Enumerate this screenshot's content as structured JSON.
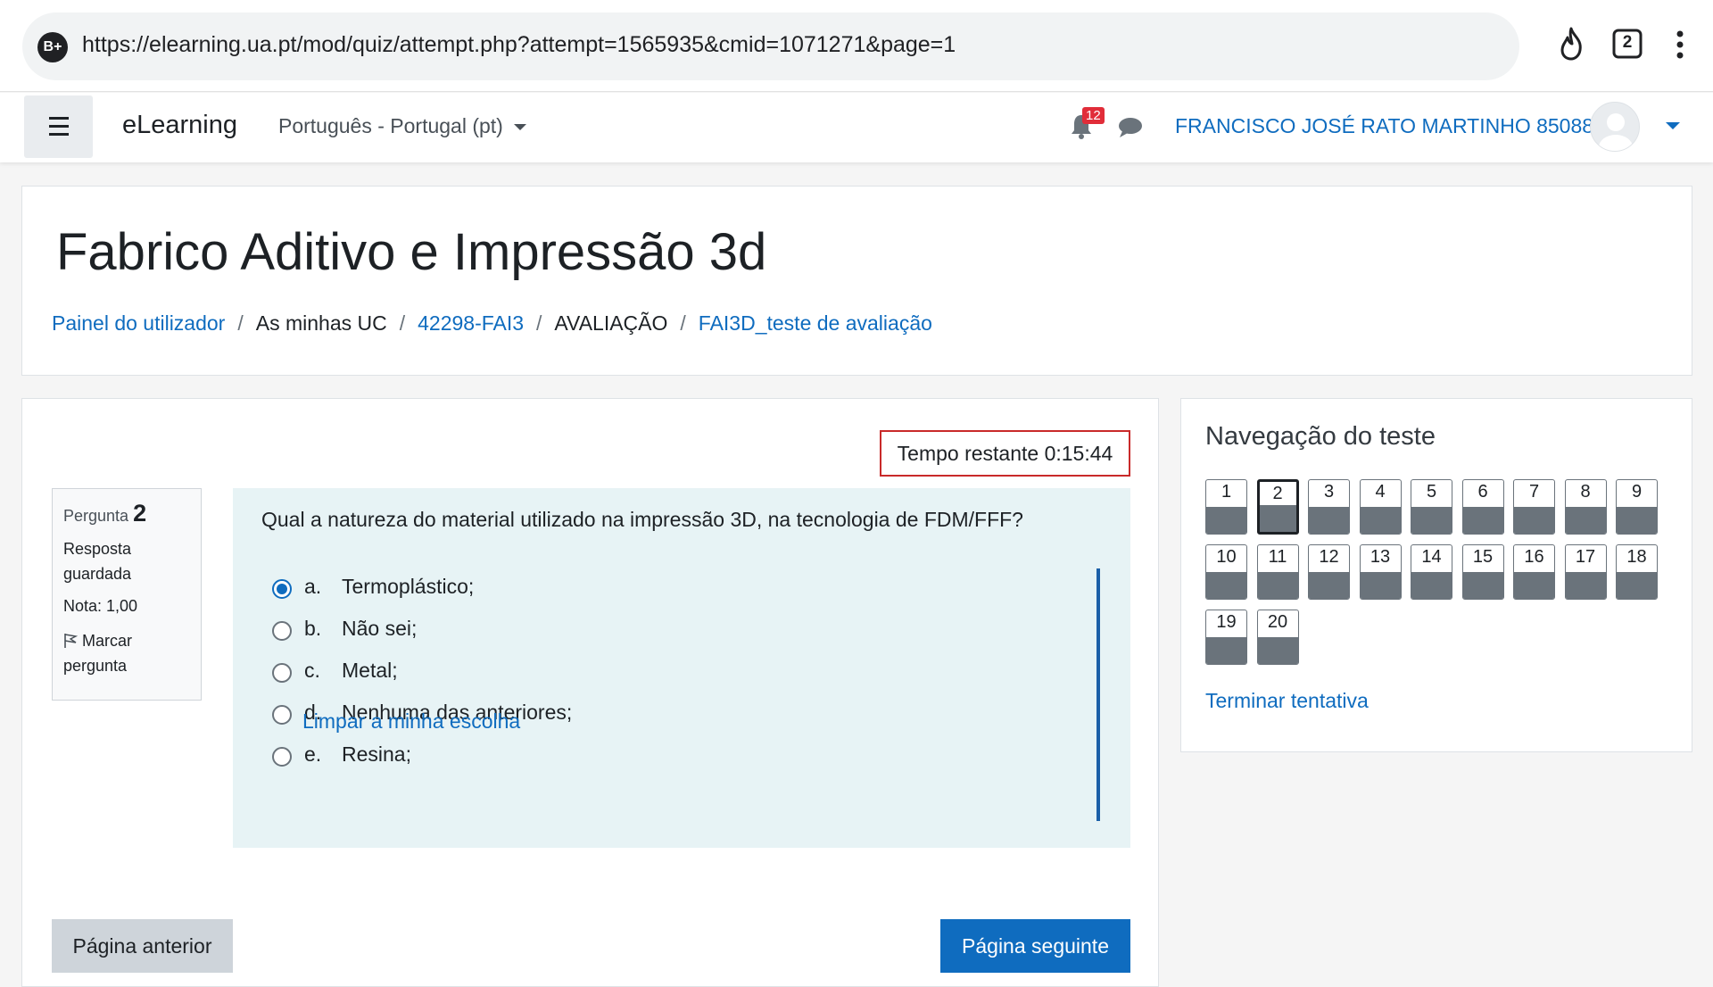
{
  "browser": {
    "site_badge": "B+",
    "url": "https://elearning.ua.pt/mod/quiz/attempt.php?attempt=1565935&cmid=1071271&page=1",
    "tab_count": "2"
  },
  "navbar": {
    "brand": "eLearning",
    "language": "Português - Portugal (pt)",
    "notification_count": "12",
    "user_name": "FRANCISCO JOSÉ RATO MARTINHO 85088"
  },
  "header": {
    "course_title": "Fabrico Aditivo e Impressão 3d",
    "breadcrumb": [
      {
        "label": "Painel do utilizador",
        "link": true
      },
      {
        "label": "As minhas UC",
        "link": false
      },
      {
        "label": "42298-FAI3",
        "link": true
      },
      {
        "label": "AVALIAÇÃO",
        "link": false
      },
      {
        "label": "FAI3D_teste de avaliação",
        "link": true
      }
    ]
  },
  "quiz": {
    "timer_text": "Tempo restante 0:15:44",
    "question_info": {
      "label": "Pergunta",
      "number": "2",
      "state": "Resposta guardada",
      "grade": "Nota: 1,00",
      "flag_label": "Marcar pergunta"
    },
    "question_text": "Qual a natureza do material utilizado na impressão 3D, na tecnologia de FDM/FFF?",
    "answers": [
      {
        "letter": "a.",
        "text": "Termoplástico;",
        "selected": true
      },
      {
        "letter": "b.",
        "text": "Não sei;",
        "selected": false
      },
      {
        "letter": "c.",
        "text": "Metal;",
        "selected": false
      },
      {
        "letter": "d.",
        "text": "Nenhuma das anteriores;",
        "selected": false
      },
      {
        "letter": "e.",
        "text": "Resina;",
        "selected": false
      }
    ],
    "clear_choice": "Limpar a minha escolha",
    "prev_button": "Página anterior",
    "next_button": "Página seguinte"
  },
  "quiz_nav": {
    "title": "Navegação do teste",
    "questions": [
      "1",
      "2",
      "3",
      "4",
      "5",
      "6",
      "7",
      "8",
      "9",
      "10",
      "11",
      "12",
      "13",
      "14",
      "15",
      "16",
      "17",
      "18",
      "19",
      "20"
    ],
    "current": "2",
    "finish_link": "Terminar tentativa"
  },
  "colors": {
    "link": "#0f6cbf",
    "primary_button": "#0f6cbf",
    "timer_border": "#c92a2a",
    "question_bg": "#e7f3f5",
    "answered_fill": "#6a737b"
  }
}
